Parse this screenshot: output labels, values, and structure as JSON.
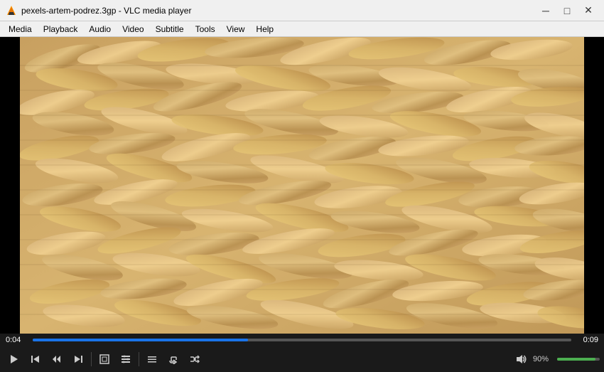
{
  "window": {
    "title": "pexels-artem-podrez.3gp - VLC media player",
    "icon": "vlc"
  },
  "titlebar": {
    "minimize_label": "─",
    "maximize_label": "□",
    "close_label": "✕"
  },
  "menubar": {
    "items": [
      {
        "label": "Media",
        "id": "media"
      },
      {
        "label": "Playback",
        "id": "playback"
      },
      {
        "label": "Audio",
        "id": "audio"
      },
      {
        "label": "Video",
        "id": "video"
      },
      {
        "label": "Subtitle",
        "id": "subtitle"
      },
      {
        "label": "Tools",
        "id": "tools"
      },
      {
        "label": "View",
        "id": "view"
      },
      {
        "label": "Help",
        "id": "help"
      }
    ]
  },
  "player": {
    "time_current": "0:04",
    "time_end": "0:09",
    "seek_percent": 40,
    "volume_percent": "90%",
    "volume_fill_percent": 90
  },
  "controls": {
    "play_label": "▶",
    "prev_label": "⏮",
    "step_back_label": "◀◀",
    "step_fwd_label": "▶▶",
    "fullscreen_label": "⛶",
    "extended_label": "⧉",
    "playlist_label": "☰",
    "loop_label": "↻",
    "random_label": "⇄"
  }
}
